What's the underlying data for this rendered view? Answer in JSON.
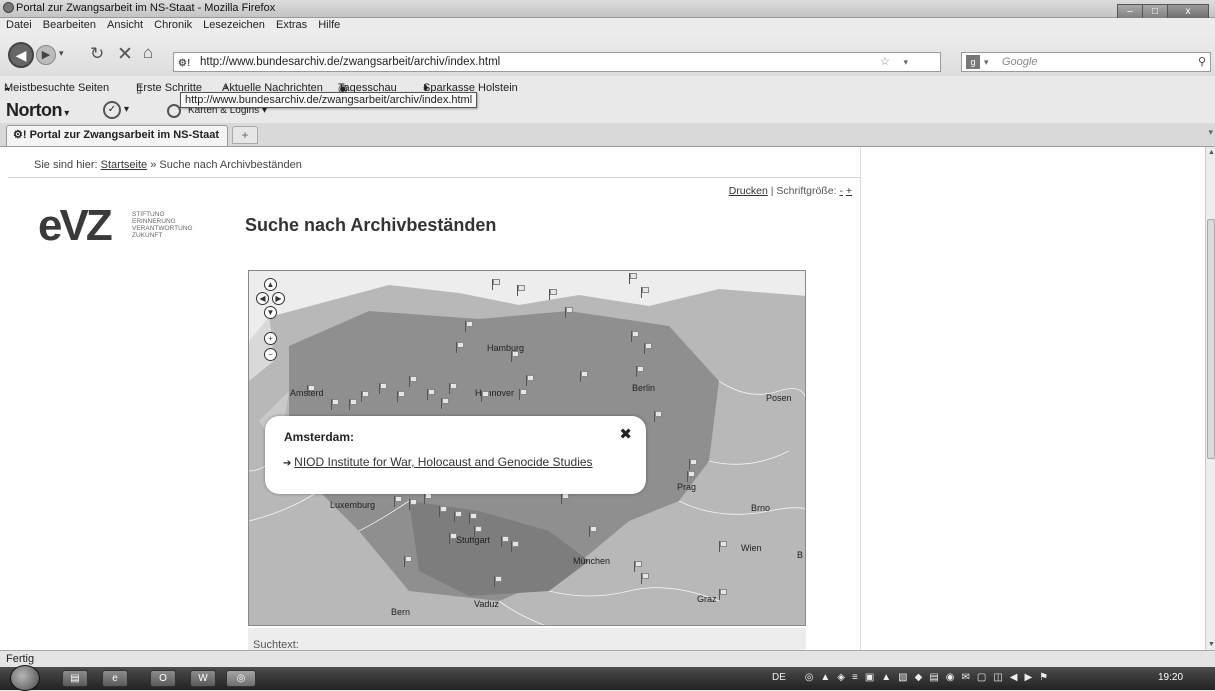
{
  "window": {
    "title": "Portal zur Zwangsarbeit im NS-Staat - Mozilla Firefox",
    "buttons": {
      "minimize": "–",
      "maximize": "□",
      "close": "x"
    }
  },
  "menu": [
    "Datei",
    "Bearbeiten",
    "Ansicht",
    "Chronik",
    "Lesezeichen",
    "Extras",
    "Hilfe"
  ],
  "nav": {
    "url": "http://www.bundesarchiv.de/zwangsarbeit/archiv/index.html",
    "search_placeholder": "Google",
    "search_engine_icon": "google-icon"
  },
  "bookmarks": [
    "Meistbesuchte Seiten",
    "Erste Schritte",
    "Aktuelle Nachrichten",
    "Tagesschau",
    "Sparkasse Holstein"
  ],
  "tooltip": "http://www.bundesarchiv.de/zwangsarbeit/archiv/index.html",
  "norton": {
    "logo": "Norton",
    "cards": "Karten & Logins"
  },
  "tabs": [
    {
      "label": "Portal zur Zwangsarbeit im NS-Staat"
    }
  ],
  "page": {
    "breadcrumb_prefix": "Sie sind hier:",
    "breadcrumb_home": "Startseite",
    "breadcrumb_sep": "»",
    "breadcrumb_current": "Suche nach Archivbeständen",
    "print_label": "Drucken",
    "sep": "|",
    "fontsize_label": "Schriftgröße:",
    "fontsize_minus": "-",
    "fontsize_plus": "+",
    "logo_text": "eVZ",
    "logo_sub": [
      "STIFTUNG",
      "ERINNERUNG",
      "VERANTWORTUNG",
      "ZUKUNFT"
    ],
    "title": "Suche nach Archivbeständen",
    "search_label": "Suchtext:"
  },
  "map": {
    "cities": [
      "Hamburg",
      "Amsterd",
      "Hannover",
      "Berlin",
      "Posen",
      "Prag",
      "Luxemburg",
      "Brno",
      "Stuttgart",
      "Wien",
      "B",
      "München",
      "Vaduz",
      "Graz",
      "Bern"
    ],
    "popup": {
      "title": "Amsterdam:",
      "link": "NIOD Institute for War, Holocaust and Genocide Studies",
      "close": "✖"
    }
  },
  "status": "Fertig",
  "taskbar": {
    "lang": "DE",
    "clock": "19:20"
  }
}
